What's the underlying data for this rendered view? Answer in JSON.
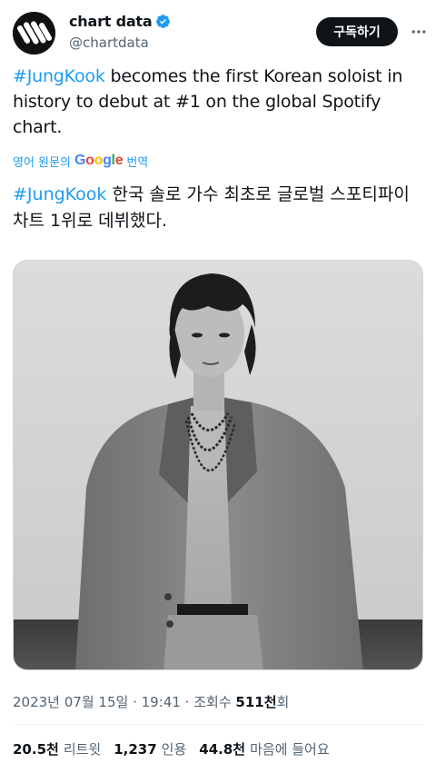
{
  "author": {
    "name": "chart data",
    "handle": "@chartdata",
    "verified": true
  },
  "subscribe_label": "구독하기",
  "more_icon": "more-dots-icon",
  "tweet": {
    "hashtag": "#JungKook",
    "text": " becomes the first Korean soloist in history to debut at #1 on the global Spotify chart."
  },
  "translate": {
    "prefix": "영어 원문의",
    "brand": "Google",
    "suffix": "번역"
  },
  "translation": {
    "hashtag": "#JungKook",
    "text": " 한국 솔로 가수 최초로 글로벌 스포티파이 차트 1위로 데뷔했다."
  },
  "media": {
    "type": "photo",
    "description_icon": "photo-image"
  },
  "meta": {
    "date": "2023년 07월 15일",
    "separator": "·",
    "time": "19:41",
    "views_label_prefix": "조회수",
    "views": "511천",
    "views_suffix": "회"
  },
  "stats": {
    "retweets": "20.5천",
    "retweets_label": "리트윗",
    "quotes": "1,237",
    "quotes_label": "인용",
    "likes": "44.8천",
    "likes_label": "마음에 들어요"
  },
  "colors": {
    "accent": "#1d9bf0",
    "text": "#0f1419",
    "secondary": "#536471",
    "button_bg": "#0f1419"
  }
}
